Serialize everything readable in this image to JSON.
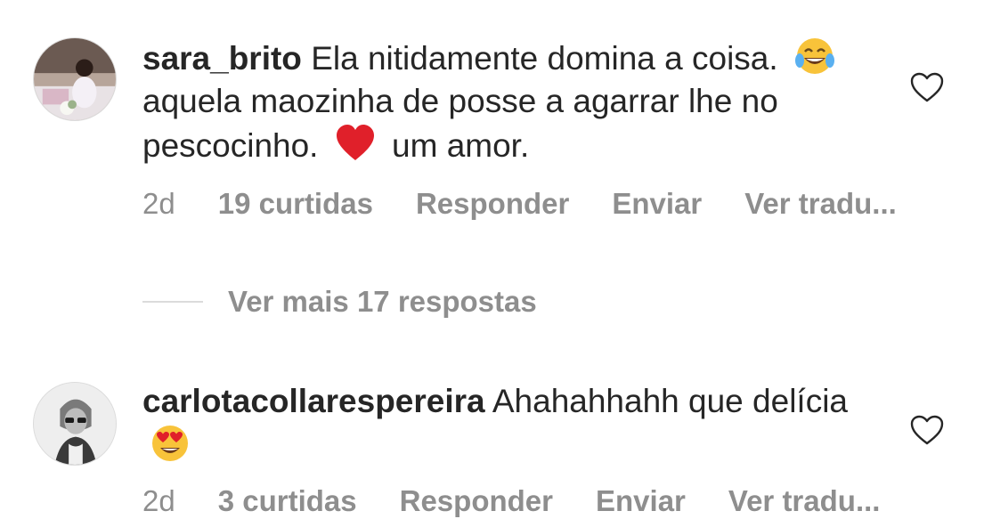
{
  "comments": [
    {
      "username": "sara_brito",
      "text_part1": " Ela nitidamente domina a coisa.",
      "emoji1": "face-with-tears-of-joy-emoji",
      "text_part2": "aquela maozinha de posse a agarrar lhe no pescocinho.",
      "emoji2": "red-heart-emoji",
      "text_part3": "um amor.",
      "time": "2d",
      "likes": "19 curtidas",
      "reply_label": "Responder",
      "send_label": "Enviar",
      "translate_label": "Ver tradu..."
    },
    {
      "username": "carlotacollarespereira",
      "text_part1": " Ahahahhahh que delícia",
      "emoji1": "smiling-face-with-heart-eyes-emoji",
      "time": "2d",
      "likes": "3 curtidas",
      "reply_label": "Responder",
      "send_label": "Enviar",
      "translate_label": "Ver tradu..."
    }
  ],
  "replies": {
    "label": "Ver mais 17 respostas"
  },
  "colors": {
    "text": "#262626",
    "secondary": "#8e8e8e",
    "divider": "#dbdbdb"
  },
  "icons": {
    "like": "heart-outline-icon"
  }
}
